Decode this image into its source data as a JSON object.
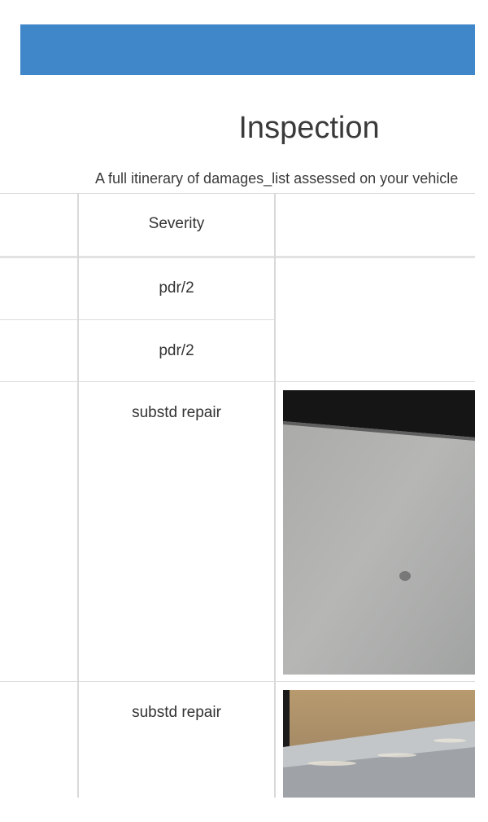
{
  "header": {
    "title": "Inspection",
    "subtitle": "A full itinerary of damages_list assessed on your vehicle"
  },
  "table": {
    "columns": {
      "severity_header": "Severity"
    },
    "rows": [
      {
        "severity": "pdr/2"
      },
      {
        "severity": "pdr/2"
      },
      {
        "severity": "substd repair"
      },
      {
        "severity": "substd repair"
      }
    ]
  },
  "colors": {
    "top_bar": "#3f87c9",
    "grid_line": "#dcdcdc"
  }
}
